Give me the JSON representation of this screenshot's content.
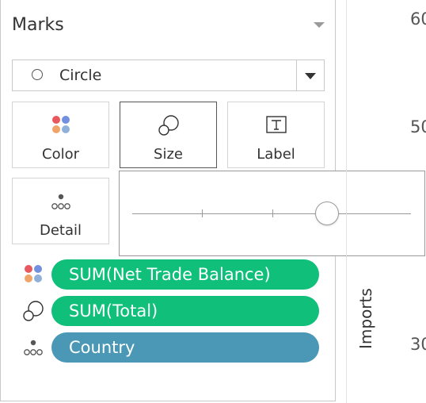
{
  "marks_card": {
    "title": "Marks",
    "mark_type": "Circle",
    "tiles": {
      "color": "Color",
      "size": "Size",
      "label": "Label",
      "detail": "Detail"
    },
    "size_slider": {
      "value_fraction": 0.7,
      "tick_count": 2
    },
    "pills": [
      {
        "field": "SUM(Net Trade Balance)",
        "encoding": "color",
        "color": "#0fbf7a"
      },
      {
        "field": "SUM(Total)",
        "encoding": "size",
        "color": "#0fbf7a"
      },
      {
        "field": "Country",
        "encoding": "detail",
        "color": "#4a98b5"
      }
    ]
  },
  "view": {
    "axis_title": "Imports",
    "tick_labels": [
      "60",
      "50",
      "30"
    ]
  },
  "colors": {
    "measure_pill": "#0fbf7a",
    "dimension_pill": "#4a98b5",
    "color_dot_red": "#e8595f",
    "color_dot_blue": "#5b7bd9",
    "color_dot_orange": "#f0a46a",
    "color_dot_lightblue": "#8fb1d9"
  },
  "icons": {
    "mark_type": "circle-icon",
    "color": "color-dots-icon",
    "size": "size-circles-icon",
    "label": "text-label-icon",
    "detail": "detail-dots-icon"
  }
}
